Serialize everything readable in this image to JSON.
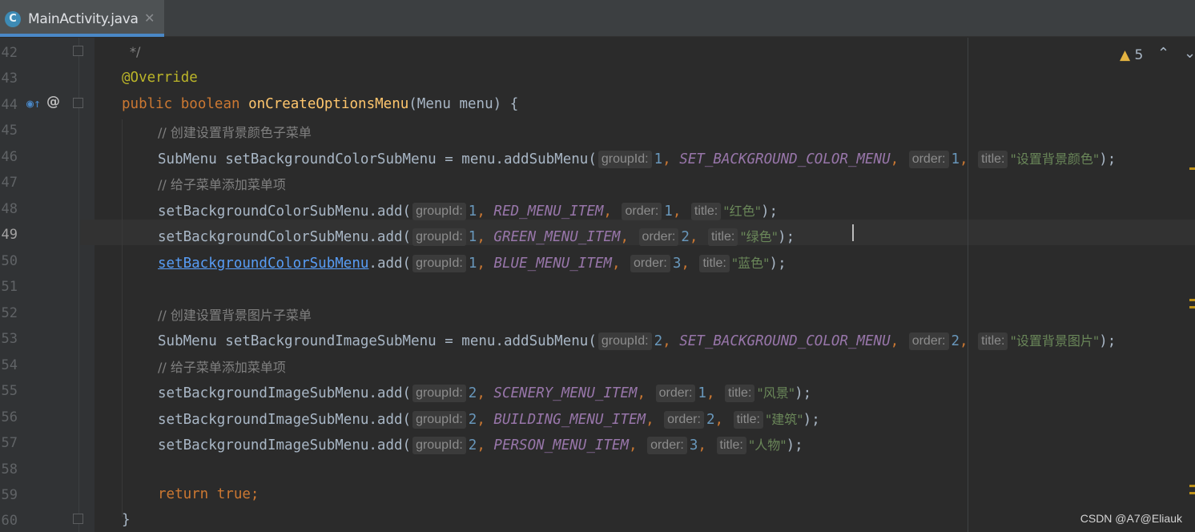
{
  "tab": {
    "icon": "C",
    "label": "MainActivity.java",
    "close": "✕"
  },
  "gutter": {
    "line_numbers": [
      "42",
      "43",
      "44",
      "45",
      "46",
      "47",
      "48",
      "49",
      "50",
      "51",
      "52",
      "53",
      "54",
      "55",
      "56",
      "57",
      "58",
      "59",
      "60"
    ]
  },
  "inspection": {
    "warning_count": "5"
  },
  "code": {
    "l42": "*/",
    "l43_ann": "@Override",
    "l44": {
      "public": "public",
      "boolean": "boolean",
      "method": "onCreateOptionsMenu",
      "params": "(Menu menu) {"
    },
    "l45": "// 创建设置背景颜色子菜单",
    "l46": {
      "decl": "SubMenu setBackgroundColorSubMenu = menu.addSubMenu(",
      "hint1": "groupId:",
      "v1": "1",
      "const": "SET_BACKGROUND_COLOR_MENU",
      "hint2": "order:",
      "v2": "1",
      "hint3": "title:",
      "str": "\"设置背景颜色\"",
      "end": ");"
    },
    "l47": "// 给子菜单添加菜单项",
    "l48": {
      "call": "setBackgroundColorSubMenu.add(",
      "hint1": "groupId:",
      "v1": "1",
      "const": "RED_MENU_ITEM",
      "hint2": "order:",
      "v2": "1",
      "hint3": "title:",
      "str": "\"红色\"",
      "end": ");"
    },
    "l49": {
      "call": "setBackgroundColorSubMenu.add(",
      "hint1": "groupId:",
      "v1": "1",
      "const": "GREEN_MENU_ITEM",
      "hint2": "order:",
      "v2": "2",
      "hint3": "title:",
      "str": "\"绿色\"",
      "end": ");"
    },
    "l50": {
      "call_link": "setBackgroundColorSubMenu",
      "call_rest": ".add(",
      "hint1": "groupId:",
      "v1": "1",
      "const": "BLUE_MENU_ITEM",
      "hint2": "order:",
      "v2": "3",
      "hint3": "title:",
      "str": "\"蓝色\"",
      "end": ");"
    },
    "l52": "// 创建设置背景图片子菜单",
    "l53": {
      "decl": "SubMenu setBackgroundImageSubMenu = menu.addSubMenu(",
      "hint1": "groupId:",
      "v1": "2",
      "const": "SET_BACKGROUND_COLOR_MENU",
      "hint2": "order:",
      "v2": "2",
      "hint3": "title:",
      "str": "\"设置背景图片\"",
      "end": ");"
    },
    "l54": "// 给子菜单添加菜单项",
    "l55": {
      "call": "setBackgroundImageSubMenu.add(",
      "hint1": "groupId:",
      "v1": "2",
      "const": "SCENERY_MENU_ITEM",
      "hint2": "order:",
      "v2": "1",
      "hint3": "title:",
      "str": "\"风景\"",
      "end": ");"
    },
    "l56": {
      "call": "setBackgroundImageSubMenu.add(",
      "hint1": "groupId:",
      "v1": "2",
      "const": "BUILDING_MENU_ITEM",
      "hint2": "order:",
      "v2": "2",
      "hint3": "title:",
      "str": "\"建筑\"",
      "end": ");"
    },
    "l57": {
      "call": "setBackgroundImageSubMenu.add(",
      "hint1": "groupId:",
      "v1": "2",
      "const": "PERSON_MENU_ITEM",
      "hint2": "order:",
      "v2": "3",
      "hint3": "title:",
      "str": "\"人物\"",
      "end": ");"
    },
    "l59": {
      "ret": "return",
      "val": "true",
      "semi": ";"
    },
    "l60": "}"
  },
  "colors": {
    "background": "#2b2b2b",
    "keyword": "#cc7832",
    "annotation": "#bbb529",
    "method": "#ffc66d",
    "comment": "#808080",
    "number": "#6897bb",
    "constant": "#9876aa",
    "string": "#6a8759"
  },
  "watermark": "CSDN @A7@Eliauk"
}
